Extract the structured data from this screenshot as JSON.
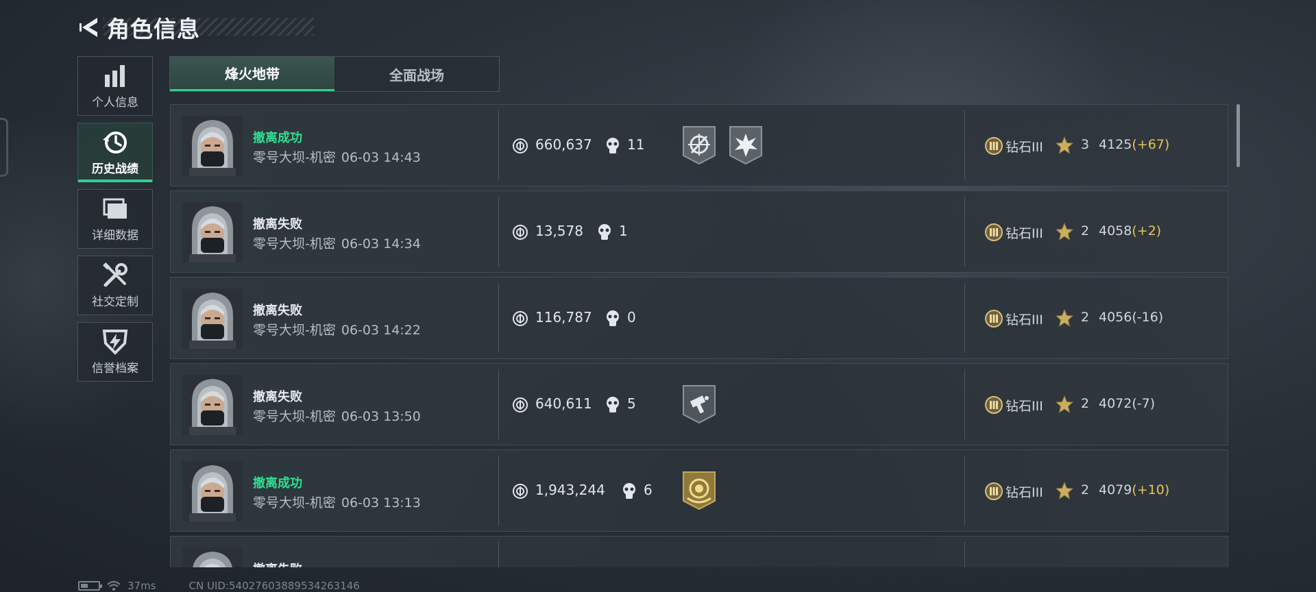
{
  "header": {
    "title": "角色信息"
  },
  "sidebar": {
    "items": [
      {
        "label": "个人信息",
        "icon": "bar-chart-icon",
        "active": false
      },
      {
        "label": "历史战绩",
        "icon": "clock-history-icon",
        "active": true
      },
      {
        "label": "详细数据",
        "icon": "folder-icon",
        "active": false
      },
      {
        "label": "社交定制",
        "icon": "tools-icon",
        "active": false
      },
      {
        "label": "信誉档案",
        "icon": "shield-bolt-icon",
        "active": false
      }
    ]
  },
  "tabs": [
    {
      "label": "烽火地带",
      "active": true
    },
    {
      "label": "全面战场",
      "active": false
    }
  ],
  "matches": [
    {
      "status": "撤离成功",
      "success": true,
      "map": "零号大坝-机密",
      "time": "06-03 14:43",
      "value": "660,637",
      "kills": "11",
      "badges": [
        "crosshair-badge-icon",
        "explosion-badge-icon"
      ],
      "rank": "钻石III",
      "stars": "3",
      "score": "4125",
      "delta": "(+67)"
    },
    {
      "status": "撤离失败",
      "success": false,
      "map": "零号大坝-机密",
      "time": "06-03 14:34",
      "value": "13,578",
      "kills": "1",
      "badges": [],
      "rank": "钻石III",
      "stars": "2",
      "score": "4058",
      "delta": "(+2)"
    },
    {
      "status": "撤离失败",
      "success": false,
      "map": "零号大坝-机密",
      "time": "06-03 14:22",
      "value": "116,787",
      "kills": "0",
      "badges": [],
      "rank": "钻石III",
      "stars": "2",
      "score": "4056",
      "delta": "(-16)"
    },
    {
      "status": "撤离失败",
      "success": false,
      "map": "零号大坝-机密",
      "time": "06-03 13:50",
      "value": "640,611",
      "kills": "5",
      "badges": [
        "hammer-badge-icon"
      ],
      "rank": "钻石III",
      "stars": "2",
      "score": "4072",
      "delta": "(-7)"
    },
    {
      "status": "撤离成功",
      "success": true,
      "map": "零号大坝-机密",
      "time": "06-03 13:13",
      "value": "1,943,244",
      "kills": "6",
      "badges": [
        "gold-emblem-badge-icon"
      ],
      "rank": "钻石III",
      "stars": "2",
      "score": "4079",
      "delta": "(+10)"
    },
    {
      "status": "撤离失败",
      "success": false,
      "map": "",
      "time": "",
      "value": "",
      "kills": "",
      "badges": [],
      "rank": "",
      "stars": "",
      "score": "",
      "delta": ""
    }
  ],
  "footer": {
    "ping": "37ms",
    "uid": "CN UID:540276038895342631​46"
  },
  "colors": {
    "accent": "#30d08e",
    "success": "#2fe08f",
    "delta_positive": "#e8c35a"
  }
}
